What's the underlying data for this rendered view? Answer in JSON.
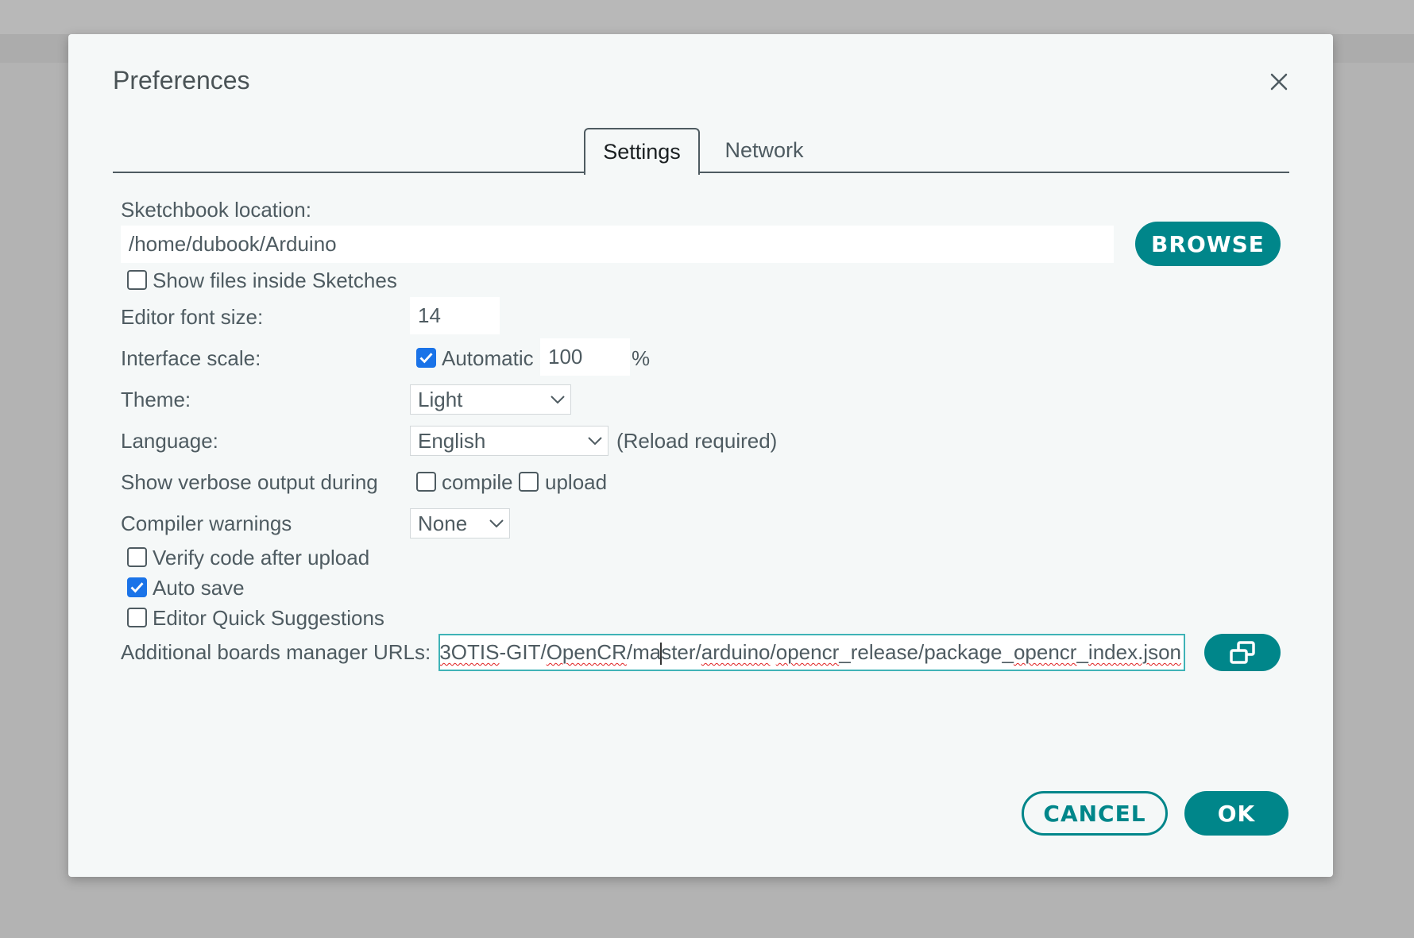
{
  "dialog": {
    "title": "Preferences",
    "tabs": [
      {
        "label": "Settings",
        "active": true
      },
      {
        "label": "Network",
        "active": false
      }
    ]
  },
  "settings": {
    "sketchbook_label": "Sketchbook location:",
    "sketchbook_value": "/home/dubook/Arduino",
    "browse_label": "BROWSE",
    "show_files_label": "Show files inside Sketches",
    "show_files_checked": false,
    "font_size_label": "Editor font size:",
    "font_size_value": "14",
    "interface_scale_label": "Interface scale:",
    "automatic_label": "Automatic",
    "automatic_checked": true,
    "scale_value": "100",
    "scale_unit": "%",
    "theme_label": "Theme:",
    "theme_value": "Light",
    "language_label": "Language:",
    "language_value": "English",
    "reload_note": "(Reload required)",
    "verbose_label": "Show verbose output during",
    "compile_label": "compile",
    "compile_checked": false,
    "upload_label": "upload",
    "upload_checked": false,
    "warnings_label": "Compiler warnings",
    "warnings_value": "None",
    "verify_label": "Verify code after upload",
    "verify_checked": false,
    "autosave_label": "Auto save",
    "autosave_checked": true,
    "quick_suggestions_label": "Editor Quick Suggestions",
    "quick_suggestions_checked": false,
    "boards_urls_label": "Additional boards manager URLs:",
    "boards_url_parts": {
      "p1": "3OTIS",
      "p2": "-GIT/",
      "p3": "OpenCR",
      "p4": "/ma",
      "p5": "ster/",
      "p6": "arduino",
      "p7": "/",
      "p8": "opencr",
      "p9": "_release/package_",
      "p10": "opencr",
      "p11": "_",
      "p12": "index.json"
    }
  },
  "footer": {
    "cancel_label": "CANCEL",
    "ok_label": "OK"
  },
  "colors": {
    "accent": "#00868a",
    "checkbox_checked": "#1a73e8",
    "text": "#4e5b61"
  }
}
